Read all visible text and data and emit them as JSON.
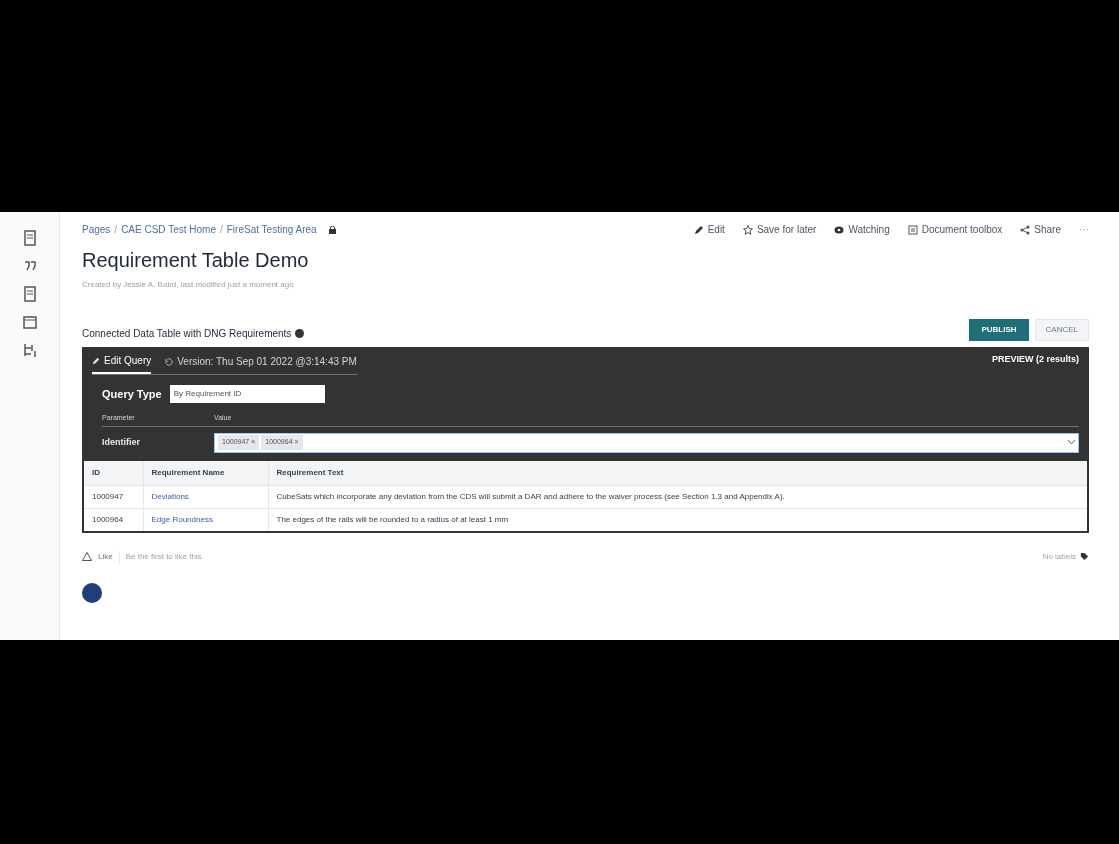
{
  "sidebar": {
    "items": [
      {
        "kind": "page"
      },
      {
        "kind": "quote"
      },
      {
        "kind": "page"
      },
      {
        "kind": "calendar"
      },
      {
        "kind": "tree"
      }
    ]
  },
  "breadcrumb": [
    {
      "label": "Pages"
    },
    {
      "separator": "/",
      "label": "CAE CSD Test Home"
    },
    {
      "separator": "/",
      "label": "FireSat Testing Area"
    }
  ],
  "page_actions": [
    {
      "kind": "edit",
      "label": "Edit"
    },
    {
      "kind": "star",
      "label": "Save for later"
    },
    {
      "kind": "eye",
      "label": "Watching"
    },
    {
      "kind": "doc",
      "label": "Document toolbox"
    },
    {
      "kind": "share",
      "label": "Share"
    },
    {
      "kind": "more",
      "label": "···"
    }
  ],
  "title": "Requirement Table Demo",
  "byline": "Created by Jessie A. Baird, last modified just a moment ago",
  "macro": {
    "heading": "Connected Data Table with DNG Requirements",
    "buttons": [
      {
        "label": "PUBLISH",
        "primary": true
      },
      {
        "label": "CANCEL",
        "primary": false
      }
    ],
    "tabs": [
      {
        "label": "Edit Query",
        "selected": true
      },
      {
        "label": "Version: Thu Sep 01 2022 @3:14:43 PM",
        "selected": false
      }
    ],
    "preview": "PREVIEW (2 results)",
    "query_type": {
      "label": "Query Type",
      "value": "By Requirement ID"
    },
    "param_headers": [
      "Parameter",
      "Value"
    ],
    "parameter": {
      "name": "Identifier",
      "chips": [
        "1000947 ×",
        "1000964 ×"
      ]
    }
  },
  "table": {
    "columns": [
      "ID",
      "Requirement Name",
      "Requirement Text"
    ],
    "rows": [
      [
        "1000947",
        "Deviations",
        "CubeSats which incorporate any deviation from the CDS will submit a DAR and adhere to the waiver process (see Section 1.3 and Appendix A)."
      ],
      [
        "1000964",
        "Edge Roundness",
        "The edges of the rails will be rounded to a radius of at least 1 mm"
      ]
    ]
  },
  "footer": {
    "like": "Like",
    "like_hint": "Be the first to like this",
    "labels": "No labels"
  }
}
